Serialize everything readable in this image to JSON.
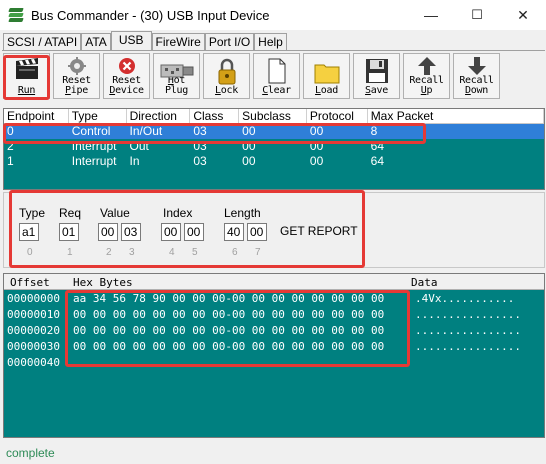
{
  "window": {
    "title": "Bus Commander - (30) USB Input Device",
    "minimize": "—",
    "maximize": "☐",
    "close": "✕"
  },
  "tabs": [
    "SCSI / ATAPI",
    "ATA",
    "USB",
    "FireWire",
    "Port I/O",
    "Help"
  ],
  "active_tab": "USB",
  "toolbar": [
    {
      "label": "Run",
      "icon": "clapperboard-icon"
    },
    {
      "label": "Reset\nPipe",
      "icon": "gear-icon"
    },
    {
      "label": "Reset\nDevice",
      "icon": "stop-icon"
    },
    {
      "label": "Hot Plug",
      "icon": "usb-plug-icon"
    },
    {
      "label": "Lock",
      "icon": "padlock-icon"
    },
    {
      "label": "Clear",
      "icon": "blank-page-icon"
    },
    {
      "label": "Load",
      "icon": "folder-icon"
    },
    {
      "label": "Save",
      "icon": "floppy-icon"
    },
    {
      "label": "Recall\nUp",
      "icon": "arrow-up-icon"
    },
    {
      "label": "Recall\nDown",
      "icon": "arrow-down-icon"
    }
  ],
  "endpoints": {
    "columns": [
      "Endpoint",
      "Type",
      "Direction",
      "Class",
      "Subclass",
      "Protocol",
      "Max Packet"
    ],
    "rows": [
      [
        "0",
        "Control",
        "In/Out",
        "03",
        "00",
        "00",
        "8"
      ],
      [
        "2",
        "Interrupt",
        "Out",
        "03",
        "00",
        "00",
        "64"
      ],
      [
        "1",
        "Interrupt",
        "In",
        "03",
        "00",
        "00",
        "64"
      ]
    ],
    "selected_row": 0
  },
  "request": {
    "type_label": "Type",
    "type": "a1",
    "req_label": "Req",
    "req": "01",
    "value_label": "Value",
    "value": [
      "00",
      "03"
    ],
    "index_label": "Index",
    "index": [
      "00",
      "00"
    ],
    "length_label": "Length",
    "length": [
      "40",
      "00"
    ],
    "indices": [
      "0",
      "1",
      "2",
      "3",
      "4",
      "5",
      "6",
      "7"
    ],
    "decoded": "GET REPORT"
  },
  "hexdump": {
    "headers": {
      "offset": "Offset",
      "bytes": "Hex Bytes",
      "data": "Data"
    },
    "rows": [
      {
        "offset": "00000000",
        "bytes": "aa 34 56 78 90 00 00 00-00 00 00 00 00 00 00 00",
        "ascii": ".4Vx..........."
      },
      {
        "offset": "00000010",
        "bytes": "00 00 00 00 00 00 00 00-00 00 00 00 00 00 00 00",
        "ascii": "................"
      },
      {
        "offset": "00000020",
        "bytes": "00 00 00 00 00 00 00 00-00 00 00 00 00 00 00 00",
        "ascii": "................"
      },
      {
        "offset": "00000030",
        "bytes": "00 00 00 00 00 00 00 00-00 00 00 00 00 00 00 00",
        "ascii": "................"
      },
      {
        "offset": "00000040",
        "bytes": "",
        "ascii": ""
      }
    ]
  },
  "status": "complete",
  "colors": {
    "teal": "#008080",
    "highlight": "#e53935",
    "selection": "#2f7fd8",
    "status_text": "#2e8b57"
  }
}
